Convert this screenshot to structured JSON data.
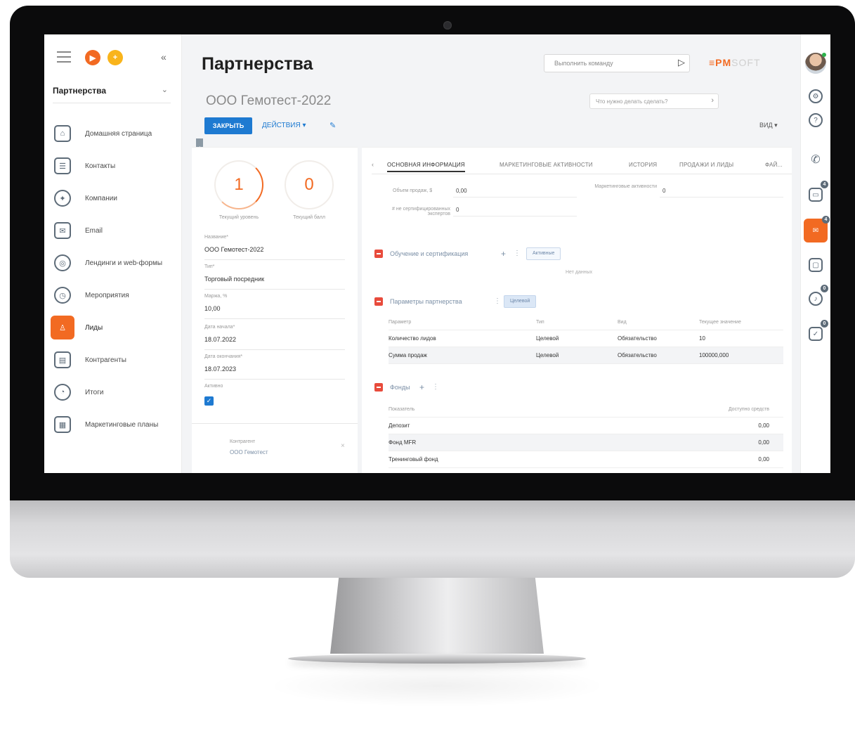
{
  "sidebar": {
    "workspace": "Партнерства",
    "items": [
      {
        "label": "Домашняя страница",
        "icon": "home-icon"
      },
      {
        "label": "Контакты",
        "icon": "contact-card-icon"
      },
      {
        "label": "Компании",
        "icon": "bulb-icon"
      },
      {
        "label": "Email",
        "icon": "email-icon"
      },
      {
        "label": "Лендинги и web-формы",
        "icon": "target-icon"
      },
      {
        "label": "Мероприятия",
        "icon": "clock-icon"
      },
      {
        "label": "Лиды",
        "icon": "lead-icon"
      },
      {
        "label": "Контрагенты",
        "icon": "document-icon"
      },
      {
        "label": "Итоги",
        "icon": "chart-pie-icon"
      },
      {
        "label": "Маркетинговые планы",
        "icon": "calendar-icon"
      }
    ]
  },
  "header": {
    "title": "Партнерства",
    "command_placeholder": "Выполнить команду",
    "logo_main": "≡PM",
    "logo_tail": "SOFT"
  },
  "record": {
    "title": "ООО Гемотест-2022",
    "hint_placeholder": "Что нужно делать сделать?",
    "close_label": "ЗАКРЫТЬ",
    "actions_label": "ДЕЙСТВИЯ ▾",
    "view_label": "ВИД ▾"
  },
  "metrics": [
    {
      "value": "1",
      "label": "Текущий уровень"
    },
    {
      "value": "0",
      "label": "Текущий балл"
    }
  ],
  "fields": [
    {
      "label": "Название*",
      "value": "ООО Гемотест-2022"
    },
    {
      "label": "Тип*",
      "value": "Торговый посредник"
    },
    {
      "label": "Маржа, %",
      "value": "10,00"
    },
    {
      "label": "Дата начала*",
      "value": "18.07.2022"
    },
    {
      "label": "Дата окончания*",
      "value": "18.07.2023"
    },
    {
      "label": "Активно",
      "value": ""
    }
  ],
  "contact": {
    "label": "Контрагент",
    "value": "ООО Гемотест"
  },
  "tabs": [
    "ОСНОВНАЯ ИНФОРМАЦИЯ",
    "МАРКЕТИНГОВЫЕ АКТИВНОСТИ",
    "ИСТОРИЯ",
    "ПРОДАЖИ И ЛИДЫ",
    "ФАЙ..."
  ],
  "summary": {
    "sales_label": "Объем продаж, $",
    "sales_value": "0,00",
    "marketing_label": "Маркетинговые активности",
    "marketing_value": "0",
    "certified_label": "# не сертифицированных экспертов",
    "certified_value": "0"
  },
  "sections": {
    "training": {
      "title": "Обучение и сертификация",
      "chip": "Активные",
      "empty": "Нет данных"
    },
    "params": {
      "title": "Параметры партнерства",
      "chip": "Целевой"
    },
    "funds": {
      "title": "Фонды"
    }
  },
  "params_table": {
    "headers": [
      "Параметр",
      "Тип",
      "Вид",
      "Текущее значение"
    ],
    "rows": [
      [
        "Количество лидов",
        "Целевой",
        "Обязательство",
        "10"
      ],
      [
        "Сумма продаж",
        "Целевой",
        "Обязательство",
        "100000,000"
      ]
    ]
  },
  "funds_table": {
    "headers": [
      "Показатель",
      "Доступно средств"
    ],
    "rows": [
      [
        "Депозит",
        "0,00"
      ],
      [
        "Фонд MFR",
        "0,00"
      ],
      [
        "Тренинговый фонд",
        "0,00"
      ]
    ]
  },
  "rail": {
    "badges": [
      "4",
      "4",
      "0",
      "0"
    ]
  }
}
